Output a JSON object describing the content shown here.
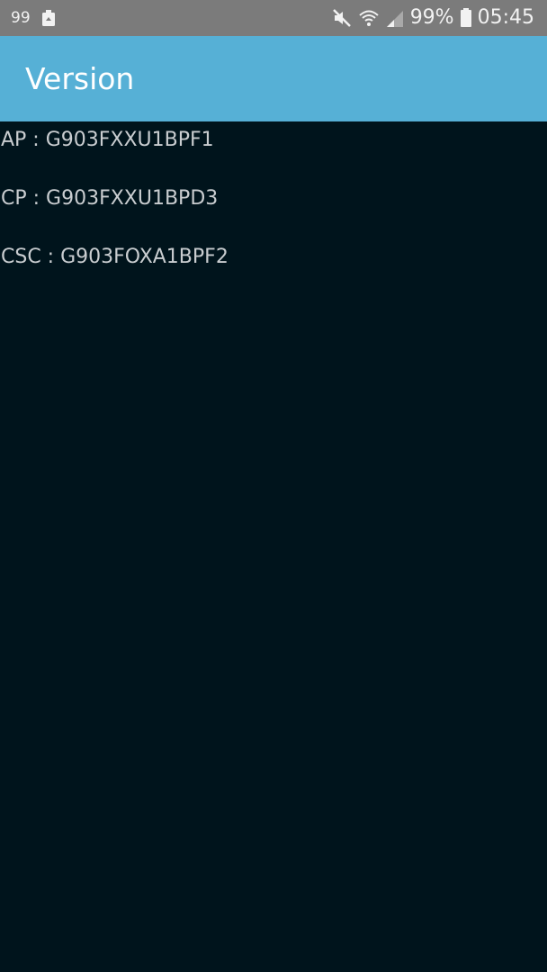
{
  "status_bar": {
    "notification_count": "99",
    "battery_percent": "99%",
    "time": "05:45",
    "icons": [
      "recycle-icon",
      "mute-icon",
      "wifi-icon",
      "signal-icon",
      "battery-icon"
    ]
  },
  "app_bar": {
    "title": "Version"
  },
  "versions": [
    {
      "text": "AP : G903FXXU1BPF1"
    },
    {
      "text": "CP : G903FXXU1BPD3"
    },
    {
      "text": "CSC : G903FOXA1BPF2"
    }
  ],
  "colors": {
    "status_bar": "#7b7b7b",
    "app_bar": "#56b0d6",
    "background": "#00141c",
    "text": "#c9cdd0"
  }
}
